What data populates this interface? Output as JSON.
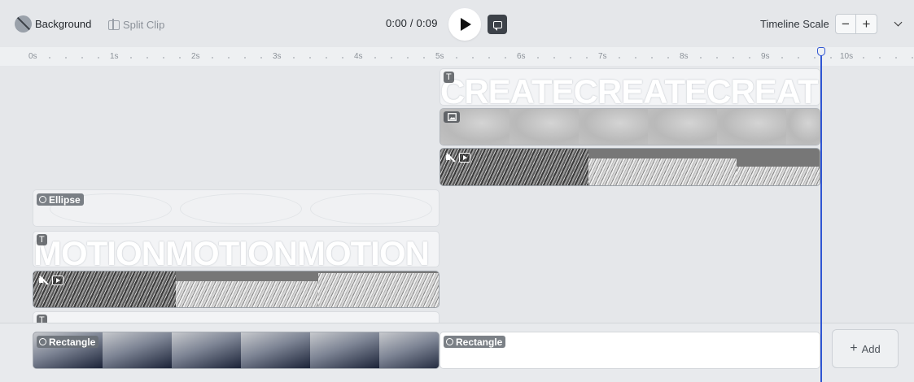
{
  "toolbar": {
    "background_label": "Background",
    "split_label": "Split Clip",
    "time_display": "0:00 / 0:09",
    "timeline_scale_label": "Timeline Scale",
    "scale_minus": "−",
    "scale_plus": "+"
  },
  "ruler": {
    "ticks": [
      "0s",
      "1s",
      "2s",
      "3s",
      "4s",
      "5s",
      "6s",
      "7s",
      "8s",
      "9s",
      "10s"
    ]
  },
  "tracks": {
    "text_clip_1": {
      "icon": "T",
      "text": "CREATECREATECREAT"
    },
    "image_clip": {
      "icon": "image-icon"
    },
    "video_clip_1": {
      "icons": [
        "mute-icon",
        "video-icon"
      ]
    },
    "ellipse_clip": {
      "label": "Ellipse"
    },
    "text_clip_2": {
      "icon": "T",
      "text": "MOTIONMOTIONMOTION"
    },
    "video_clip_2": {
      "icons": [
        "mute-icon",
        "video-icon"
      ]
    },
    "text_clip_3": {
      "icon": "T"
    }
  },
  "bottom": {
    "rect_clip_1_label": "Rectangle",
    "rect_clip_2_label": "Rectangle",
    "add_label": "Add"
  },
  "colors": {
    "playhead": "#3056d3",
    "background": "#e5e7ea"
  }
}
